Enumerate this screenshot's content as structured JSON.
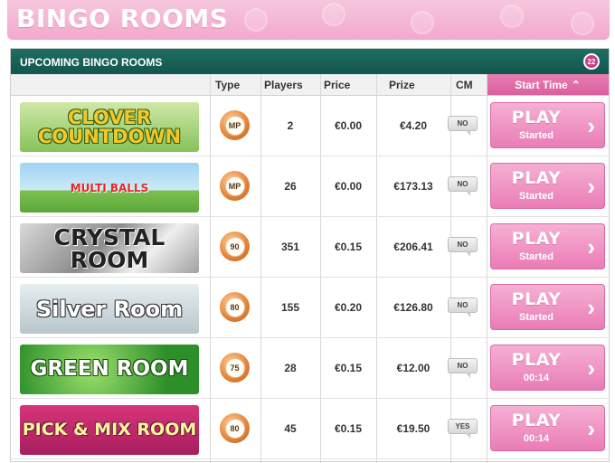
{
  "header": {
    "title": "BINGO ROOMS"
  },
  "panel": {
    "title": "UPCOMING BINGO ROOMS",
    "icon": "bingo-ball-icon"
  },
  "columns": {
    "type": "Type",
    "players": "Players",
    "price": "Price",
    "prize": "Prize",
    "cm": "CM",
    "start_time": "Start Time"
  },
  "play_label": "PLAY",
  "rooms": [
    {
      "name": "CLOVER COUNTDOWN",
      "type": "MP",
      "players": "2",
      "price": "€0.00",
      "prize": "€4.20",
      "cm": "NO",
      "status": "Started"
    },
    {
      "name": "MULTI BALLS",
      "type": "MP",
      "players": "26",
      "price": "€0.00",
      "prize": "€173.13",
      "cm": "NO",
      "status": "Started"
    },
    {
      "name": "CRYSTAL ROOM",
      "type": "90",
      "players": "351",
      "price": "€0.15",
      "prize": "€206.41",
      "cm": "NO",
      "status": "Started"
    },
    {
      "name": "Silver Room",
      "type": "80",
      "players": "155",
      "price": "€0.20",
      "prize": "€126.80",
      "cm": "NO",
      "status": "Started"
    },
    {
      "name": "GREEN ROOM",
      "type": "75",
      "players": "28",
      "price": "€0.15",
      "prize": "€12.00",
      "cm": "NO",
      "status": "00:14"
    },
    {
      "name": "PICK & MIX ROOM",
      "type": "80",
      "players": "45",
      "price": "€0.15",
      "prize": "€19.50",
      "cm": "YES",
      "status": "00:14"
    }
  ],
  "colors": {
    "accent_pink": "#e97cb6",
    "header_green": "#12564c"
  }
}
